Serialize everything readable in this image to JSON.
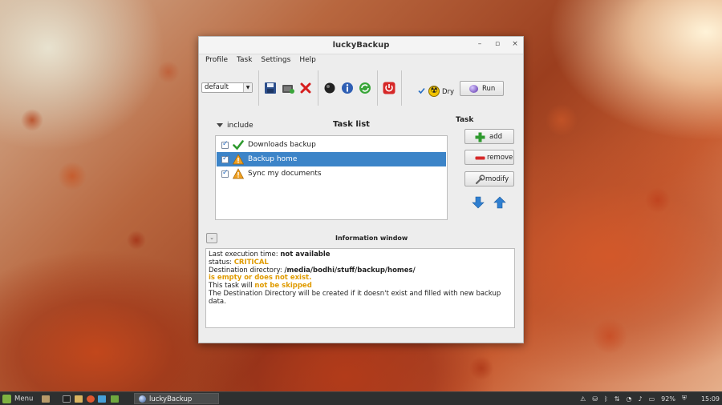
{
  "window": {
    "title": "luckyBackup",
    "controls": [
      "–",
      "▫",
      "×"
    ]
  },
  "menu": [
    "Profile",
    "Task",
    "Settings",
    "Help"
  ],
  "toolbar": {
    "profile_value": "default",
    "dry_label": "Dry",
    "run_label": "Run"
  },
  "tasks_header": {
    "include_label": "include",
    "list_title": "Task list",
    "side_title": "Task"
  },
  "tasks": [
    {
      "label": "Downloads backup",
      "status": "ok",
      "checked": true
    },
    {
      "label": "Backup home",
      "status": "warning",
      "checked": true,
      "selected": true
    },
    {
      "label": "Sync my documents",
      "status": "warning",
      "checked": true
    }
  ],
  "side_buttons": {
    "add": "add",
    "remove": "remove",
    "modify": "modify"
  },
  "info": {
    "title": "Information window",
    "line1_prefix": "Last execution time: ",
    "line1_value": "not available",
    "line2_prefix": "status: ",
    "line2_value": "CRITICAL",
    "line3_prefix": "Destination directory: ",
    "line3_value": "/media/bodhi/stuff/backup/homes/",
    "line4": "is empty or does not exist.",
    "line5_prefix": "This task will ",
    "line5_value": "not be skipped",
    "line6": "The Destination Directory will be created if it doesn't exist and filled with new backup data."
  },
  "taskbar": {
    "menu_label": "Menu",
    "active_task": "luckyBackup",
    "battery": "92%",
    "clock": "15:09"
  },
  "colors": {
    "selection": "#3c84c8",
    "warning_text": "#e09b00"
  }
}
